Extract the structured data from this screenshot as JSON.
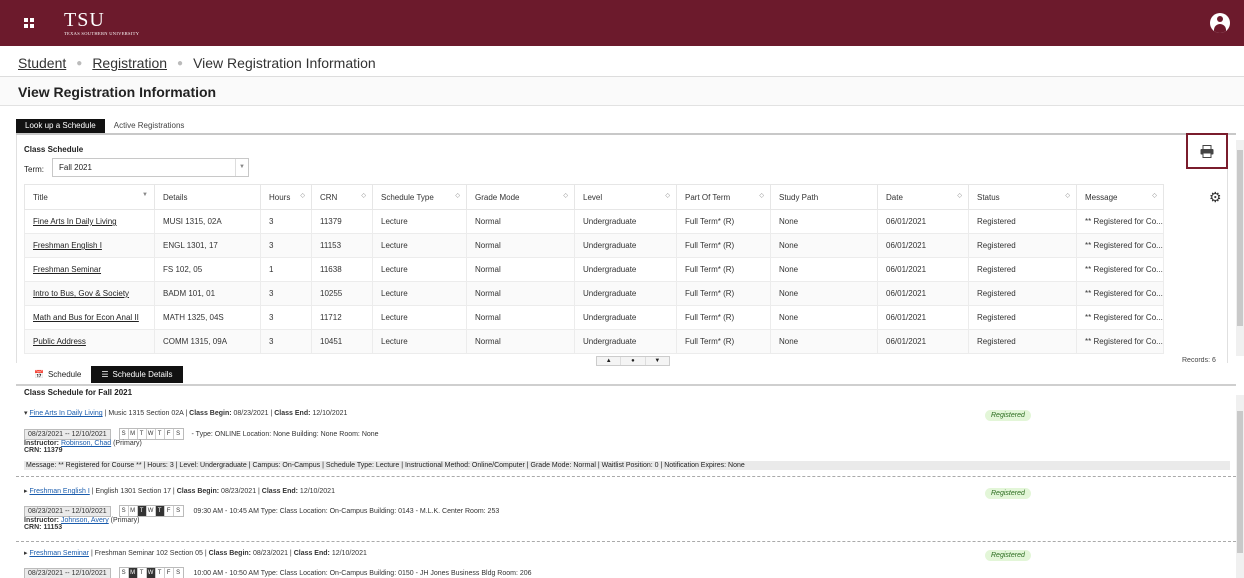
{
  "header": {
    "logo_main": "TSU",
    "logo_sub": "TEXAS SOUTHERN UNIVERSITY",
    "brand_color": "#6c1a2c"
  },
  "breadcrumb": {
    "student": "Student",
    "registration": "Registration",
    "current": "View Registration Information"
  },
  "page_title": "View Registration Information",
  "tabs": {
    "lookup": "Look up a Schedule",
    "active": "Active Registrations"
  },
  "class_schedule": {
    "title": "Class Schedule",
    "term_label": "Term:",
    "term_value": "Fall 2021"
  },
  "table": {
    "columns": [
      "Title",
      "Details",
      "Hours",
      "CRN",
      "Schedule Type",
      "Grade Mode",
      "Level",
      "Part Of Term",
      "Study Path",
      "Date",
      "Status",
      "Message"
    ],
    "rows": [
      [
        "Fine Arts In Daily Living",
        "MUSI 1315, 02A",
        "3",
        "11379",
        "Lecture",
        "Normal",
        "Undergraduate",
        "Full Term* (R)",
        "None",
        "06/01/2021",
        "Registered",
        "** Registered for Co..."
      ],
      [
        "Freshman English I",
        "ENGL 1301, 17",
        "3",
        "11153",
        "Lecture",
        "Normal",
        "Undergraduate",
        "Full Term* (R)",
        "None",
        "06/01/2021",
        "Registered",
        "** Registered for Co..."
      ],
      [
        "Freshman Seminar",
        "FS 102, 05",
        "1",
        "11638",
        "Lecture",
        "Normal",
        "Undergraduate",
        "Full Term* (R)",
        "None",
        "06/01/2021",
        "Registered",
        "** Registered for Co..."
      ],
      [
        "Intro to Bus, Gov & Society",
        "BADM 101, 01",
        "3",
        "10255",
        "Lecture",
        "Normal",
        "Undergraduate",
        "Full Term* (R)",
        "None",
        "06/01/2021",
        "Registered",
        "** Registered for Co..."
      ],
      [
        "Math and Bus for Econ Anal II",
        "MATH 1325, 04S",
        "3",
        "11712",
        "Lecture",
        "Normal",
        "Undergraduate",
        "Full Term* (R)",
        "None",
        "06/01/2021",
        "Registered",
        "** Registered for Co..."
      ],
      [
        "Public Address",
        "COMM 1315, 09A",
        "3",
        "10451",
        "Lecture",
        "Normal",
        "Undergraduate",
        "Full Term* (R)",
        "None",
        "06/01/2021",
        "Registered",
        "** Registered for Co..."
      ]
    ],
    "records": "Records: 6"
  },
  "lower_tabs": {
    "schedule": "Schedule",
    "details": "Schedule Details"
  },
  "lower_title": "Class Schedule for Fall 2021",
  "details": [
    {
      "title": "Fine Arts In Daily Living",
      "summary": " | Music 1315 Section 02A | ",
      "begin_label": "Class Begin:",
      "begin": " 08/23/2021 | ",
      "end_label": "Class End:",
      "end": " 12/10/2021",
      "status": "Registered",
      "dates": "08/23/2021 -- 12/10/2021",
      "time": "",
      "type_line": "- Type: ONLINE Location: None Building: None Room: None",
      "instructor_label": "Instructor:",
      "instructor": "Robinson, Chad",
      "instructor_role": " (Primary)",
      "crn": "CRN: 11379",
      "message": "Message: ** Registered for Course ** | Hours: 3 | Level: Undergraduate | Campus: On-Campus | Schedule Type: Lecture | Instructional Method: Online/Computer | Grade Mode: Normal | Waitlist Position: 0 | Notification Expires: None"
    },
    {
      "title": "Freshman English I",
      "summary": " | English 1301 Section 17 | ",
      "begin_label": "Class Begin:",
      "begin": " 08/23/2021 | ",
      "end_label": "Class End:",
      "end": " 12/10/2021",
      "status": "Registered",
      "dates": "08/23/2021 -- 12/10/2021",
      "time": "09:30 AM - 10:45 AM",
      "type_line": "Type: Class Location: On-Campus Building: 0143 - M.L.K. Center Room: 253",
      "instructor_label": "Instructor:",
      "instructor": "Johnson, Avery",
      "instructor_role": " (Primary)",
      "crn": "CRN: 11153"
    },
    {
      "title": "Freshman Seminar",
      "summary": " | Freshman Seminar 102 Section 05 | ",
      "begin_label": "Class Begin:",
      "begin": " 08/23/2021 | ",
      "end_label": "Class End:",
      "end": " 12/10/2021",
      "status": "Registered",
      "dates": "08/23/2021 -- 12/10/2021",
      "time": "10:00 AM - 10:50 AM",
      "type_line": "Type: Class Location: On-Campus Building: 0150 - JH Jones Business Bldg Room: 206"
    }
  ],
  "days": [
    "S",
    "M",
    "T",
    "W",
    "T",
    "F",
    "S"
  ]
}
